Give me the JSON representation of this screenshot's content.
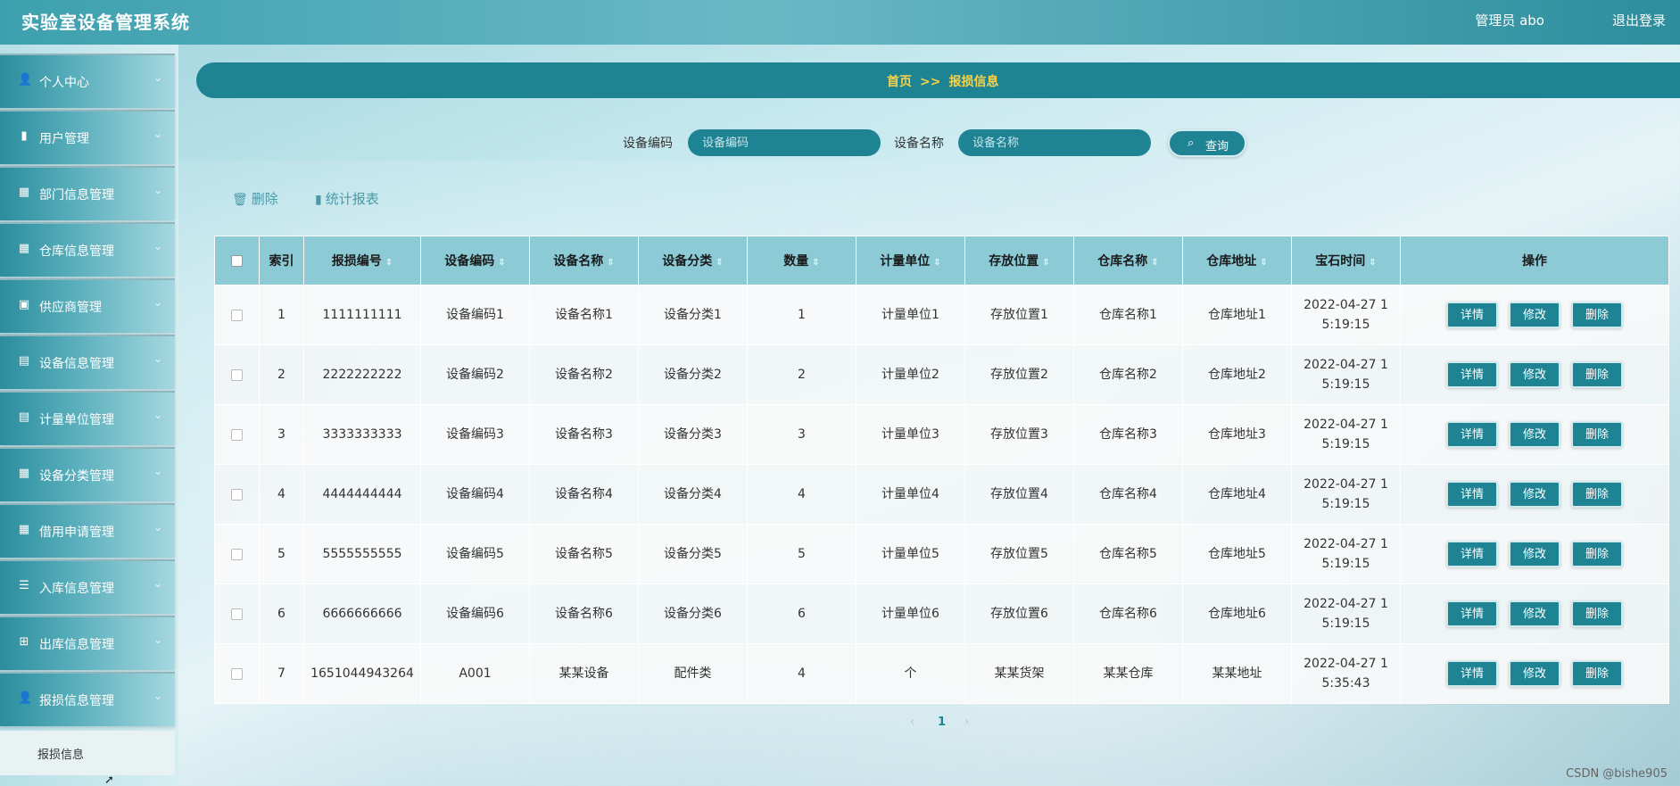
{
  "header": {
    "title": "实验室设备管理系统",
    "admin_label": "管理员 abo",
    "logout_label": "退出登录"
  },
  "sidebar": {
    "items": [
      {
        "label": "个人中心",
        "icon": "person-icon"
      },
      {
        "label": "用户管理",
        "icon": "bar-chart-icon"
      },
      {
        "label": "部门信息管理",
        "icon": "grid-icon"
      },
      {
        "label": "仓库信息管理",
        "icon": "grid-icon"
      },
      {
        "label": "供应商管理",
        "icon": "briefcase-icon"
      },
      {
        "label": "设备信息管理",
        "icon": "clipboard-icon"
      },
      {
        "label": "计量单位管理",
        "icon": "clipboard-icon"
      },
      {
        "label": "设备分类管理",
        "icon": "grid-icon"
      },
      {
        "label": "借用申请管理",
        "icon": "grid-icon"
      },
      {
        "label": "入库信息管理",
        "icon": "list-icon"
      },
      {
        "label": "出库信息管理",
        "icon": "apps-icon"
      },
      {
        "label": "报损信息管理",
        "icon": "person-icon"
      }
    ],
    "active_sub": "报损信息"
  },
  "breadcrumb": {
    "home": "首页",
    "sep": ">>",
    "current": "报损信息"
  },
  "search": {
    "code_label": "设备编码",
    "code_placeholder": "设备编码",
    "name_label": "设备名称",
    "name_placeholder": "设备名称",
    "button_label": "查询"
  },
  "actions": {
    "delete_label": "删除",
    "report_label": "统计报表"
  },
  "table": {
    "headers": [
      "索引",
      "报损编号",
      "设备编码",
      "设备名称",
      "设备分类",
      "数量",
      "计量单位",
      "存放位置",
      "仓库名称",
      "仓库地址",
      "宝石时间",
      "操作"
    ],
    "ops": [
      "详情",
      "修改",
      "删除"
    ],
    "rows": [
      {
        "idx": "1",
        "no": "1111111111",
        "code": "设备编码1",
        "name": "设备名称1",
        "cat": "设备分类1",
        "qty": "1",
        "unit": "计量单位1",
        "loc": "存放位置1",
        "wh": "仓库名称1",
        "addr": "仓库地址1",
        "time1": "2022-04-27 1",
        "time2": "5:19:15"
      },
      {
        "idx": "2",
        "no": "2222222222",
        "code": "设备编码2",
        "name": "设备名称2",
        "cat": "设备分类2",
        "qty": "2",
        "unit": "计量单位2",
        "loc": "存放位置2",
        "wh": "仓库名称2",
        "addr": "仓库地址2",
        "time1": "2022-04-27 1",
        "time2": "5:19:15"
      },
      {
        "idx": "3",
        "no": "3333333333",
        "code": "设备编码3",
        "name": "设备名称3",
        "cat": "设备分类3",
        "qty": "3",
        "unit": "计量单位3",
        "loc": "存放位置3",
        "wh": "仓库名称3",
        "addr": "仓库地址3",
        "time1": "2022-04-27 1",
        "time2": "5:19:15"
      },
      {
        "idx": "4",
        "no": "4444444444",
        "code": "设备编码4",
        "name": "设备名称4",
        "cat": "设备分类4",
        "qty": "4",
        "unit": "计量单位4",
        "loc": "存放位置4",
        "wh": "仓库名称4",
        "addr": "仓库地址4",
        "time1": "2022-04-27 1",
        "time2": "5:19:15"
      },
      {
        "idx": "5",
        "no": "5555555555",
        "code": "设备编码5",
        "name": "设备名称5",
        "cat": "设备分类5",
        "qty": "5",
        "unit": "计量单位5",
        "loc": "存放位置5",
        "wh": "仓库名称5",
        "addr": "仓库地址5",
        "time1": "2022-04-27 1",
        "time2": "5:19:15"
      },
      {
        "idx": "6",
        "no": "6666666666",
        "code": "设备编码6",
        "name": "设备名称6",
        "cat": "设备分类6",
        "qty": "6",
        "unit": "计量单位6",
        "loc": "存放位置6",
        "wh": "仓库名称6",
        "addr": "仓库地址6",
        "time1": "2022-04-27 1",
        "time2": "5:19:15"
      },
      {
        "idx": "7",
        "no": "1651044943264",
        "code": "A001",
        "name": "某某设备",
        "cat": "配件类",
        "qty": "4",
        "unit": "个",
        "loc": "某某货架",
        "wh": "某某仓库",
        "addr": "某某地址",
        "time1": "2022-04-27 1",
        "time2": "5:35:43"
      }
    ]
  },
  "pager": {
    "prev": "‹",
    "current": "1",
    "next": "›"
  },
  "watermark": "CSDN @bishe905",
  "colors": {
    "primary": "#1e8494",
    "header_bg": "#8ccad6",
    "breadcrumb_text": "#f8d34a"
  }
}
